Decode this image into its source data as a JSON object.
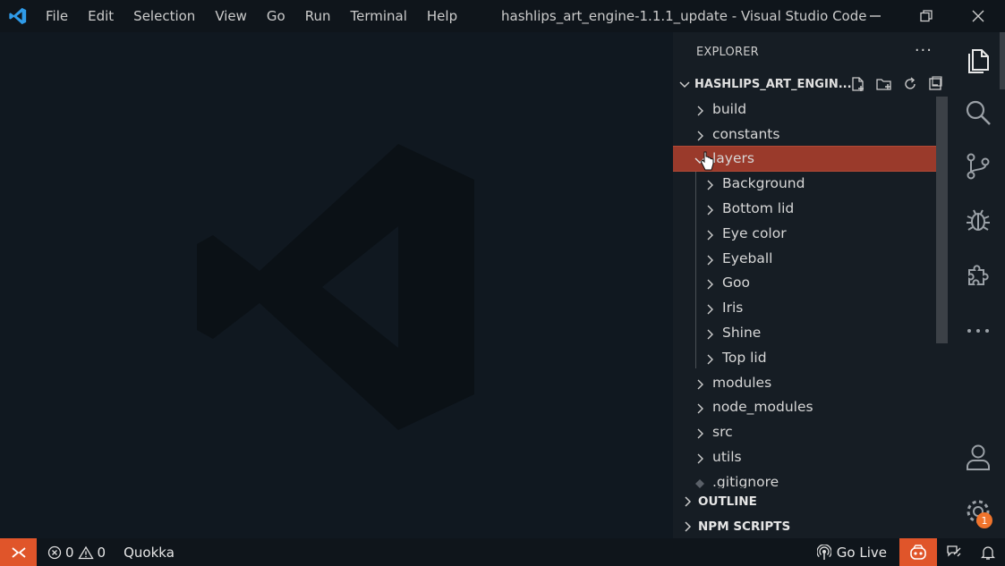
{
  "menu": [
    "File",
    "Edit",
    "Selection",
    "View",
    "Go",
    "Run",
    "Terminal",
    "Help"
  ],
  "window_title": "hashlips_art_engine-1.1.1_update - Visual Studio Code",
  "explorer": {
    "title": "EXPLORER",
    "more": "···",
    "root": "HASHLIPS_ART_ENGIN...",
    "items": [
      {
        "label": "build",
        "type": "folder",
        "level": 0
      },
      {
        "label": "constants",
        "type": "folder",
        "level": 0
      },
      {
        "label": "layers",
        "type": "folder-open",
        "level": 0,
        "selected": true
      },
      {
        "label": "Background",
        "type": "folder",
        "level": 1
      },
      {
        "label": "Bottom lid",
        "type": "folder",
        "level": 1
      },
      {
        "label": "Eye color",
        "type": "folder",
        "level": 1
      },
      {
        "label": "Eyeball",
        "type": "folder",
        "level": 1
      },
      {
        "label": "Goo",
        "type": "folder",
        "level": 1
      },
      {
        "label": "Iris",
        "type": "folder",
        "level": 1
      },
      {
        "label": "Shine",
        "type": "folder",
        "level": 1
      },
      {
        "label": "Top lid",
        "type": "folder",
        "level": 1
      },
      {
        "label": "modules",
        "type": "folder",
        "level": 0
      },
      {
        "label": "node_modules",
        "type": "folder",
        "level": 0
      },
      {
        "label": "src",
        "type": "folder",
        "level": 0
      },
      {
        "label": "utils",
        "type": "folder",
        "level": 0
      },
      {
        "label": ".gitignore",
        "type": "file",
        "level": 0
      }
    ],
    "sections": [
      "OUTLINE",
      "NPM SCRIPTS"
    ]
  },
  "status": {
    "errors": "0",
    "warnings": "0",
    "quokka": "Quokka",
    "go_live": "Go Live",
    "settings_badge": "1"
  },
  "colors": {
    "selected_row": "#9a3a2b",
    "remote_button": "#e0552a",
    "badge": "#f0742c"
  }
}
